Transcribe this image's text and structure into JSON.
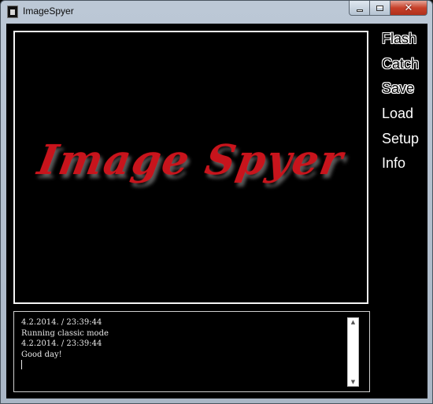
{
  "window": {
    "title": "ImageSpyer",
    "minimize_icon": "minimize-icon",
    "maximize_icon": "maximize-icon",
    "close_icon": "close-icon",
    "close_glyph": "✕"
  },
  "preview": {
    "logo_text": "Image Spyer",
    "logo_color": "#c8141c"
  },
  "menu": {
    "items": [
      {
        "label": "Flash"
      },
      {
        "label": "Catch"
      },
      {
        "label": "Save"
      },
      {
        "label": "Load"
      },
      {
        "label": "Setup"
      },
      {
        "label": "Info"
      }
    ]
  },
  "log": {
    "lines": [
      "4.2.2014. / 23:39:44",
      "Running classic mode",
      "4.2.2014. / 23:39:44",
      "Good day!"
    ],
    "scroll_up_glyph": "▲",
    "scroll_down_glyph": "▼"
  }
}
